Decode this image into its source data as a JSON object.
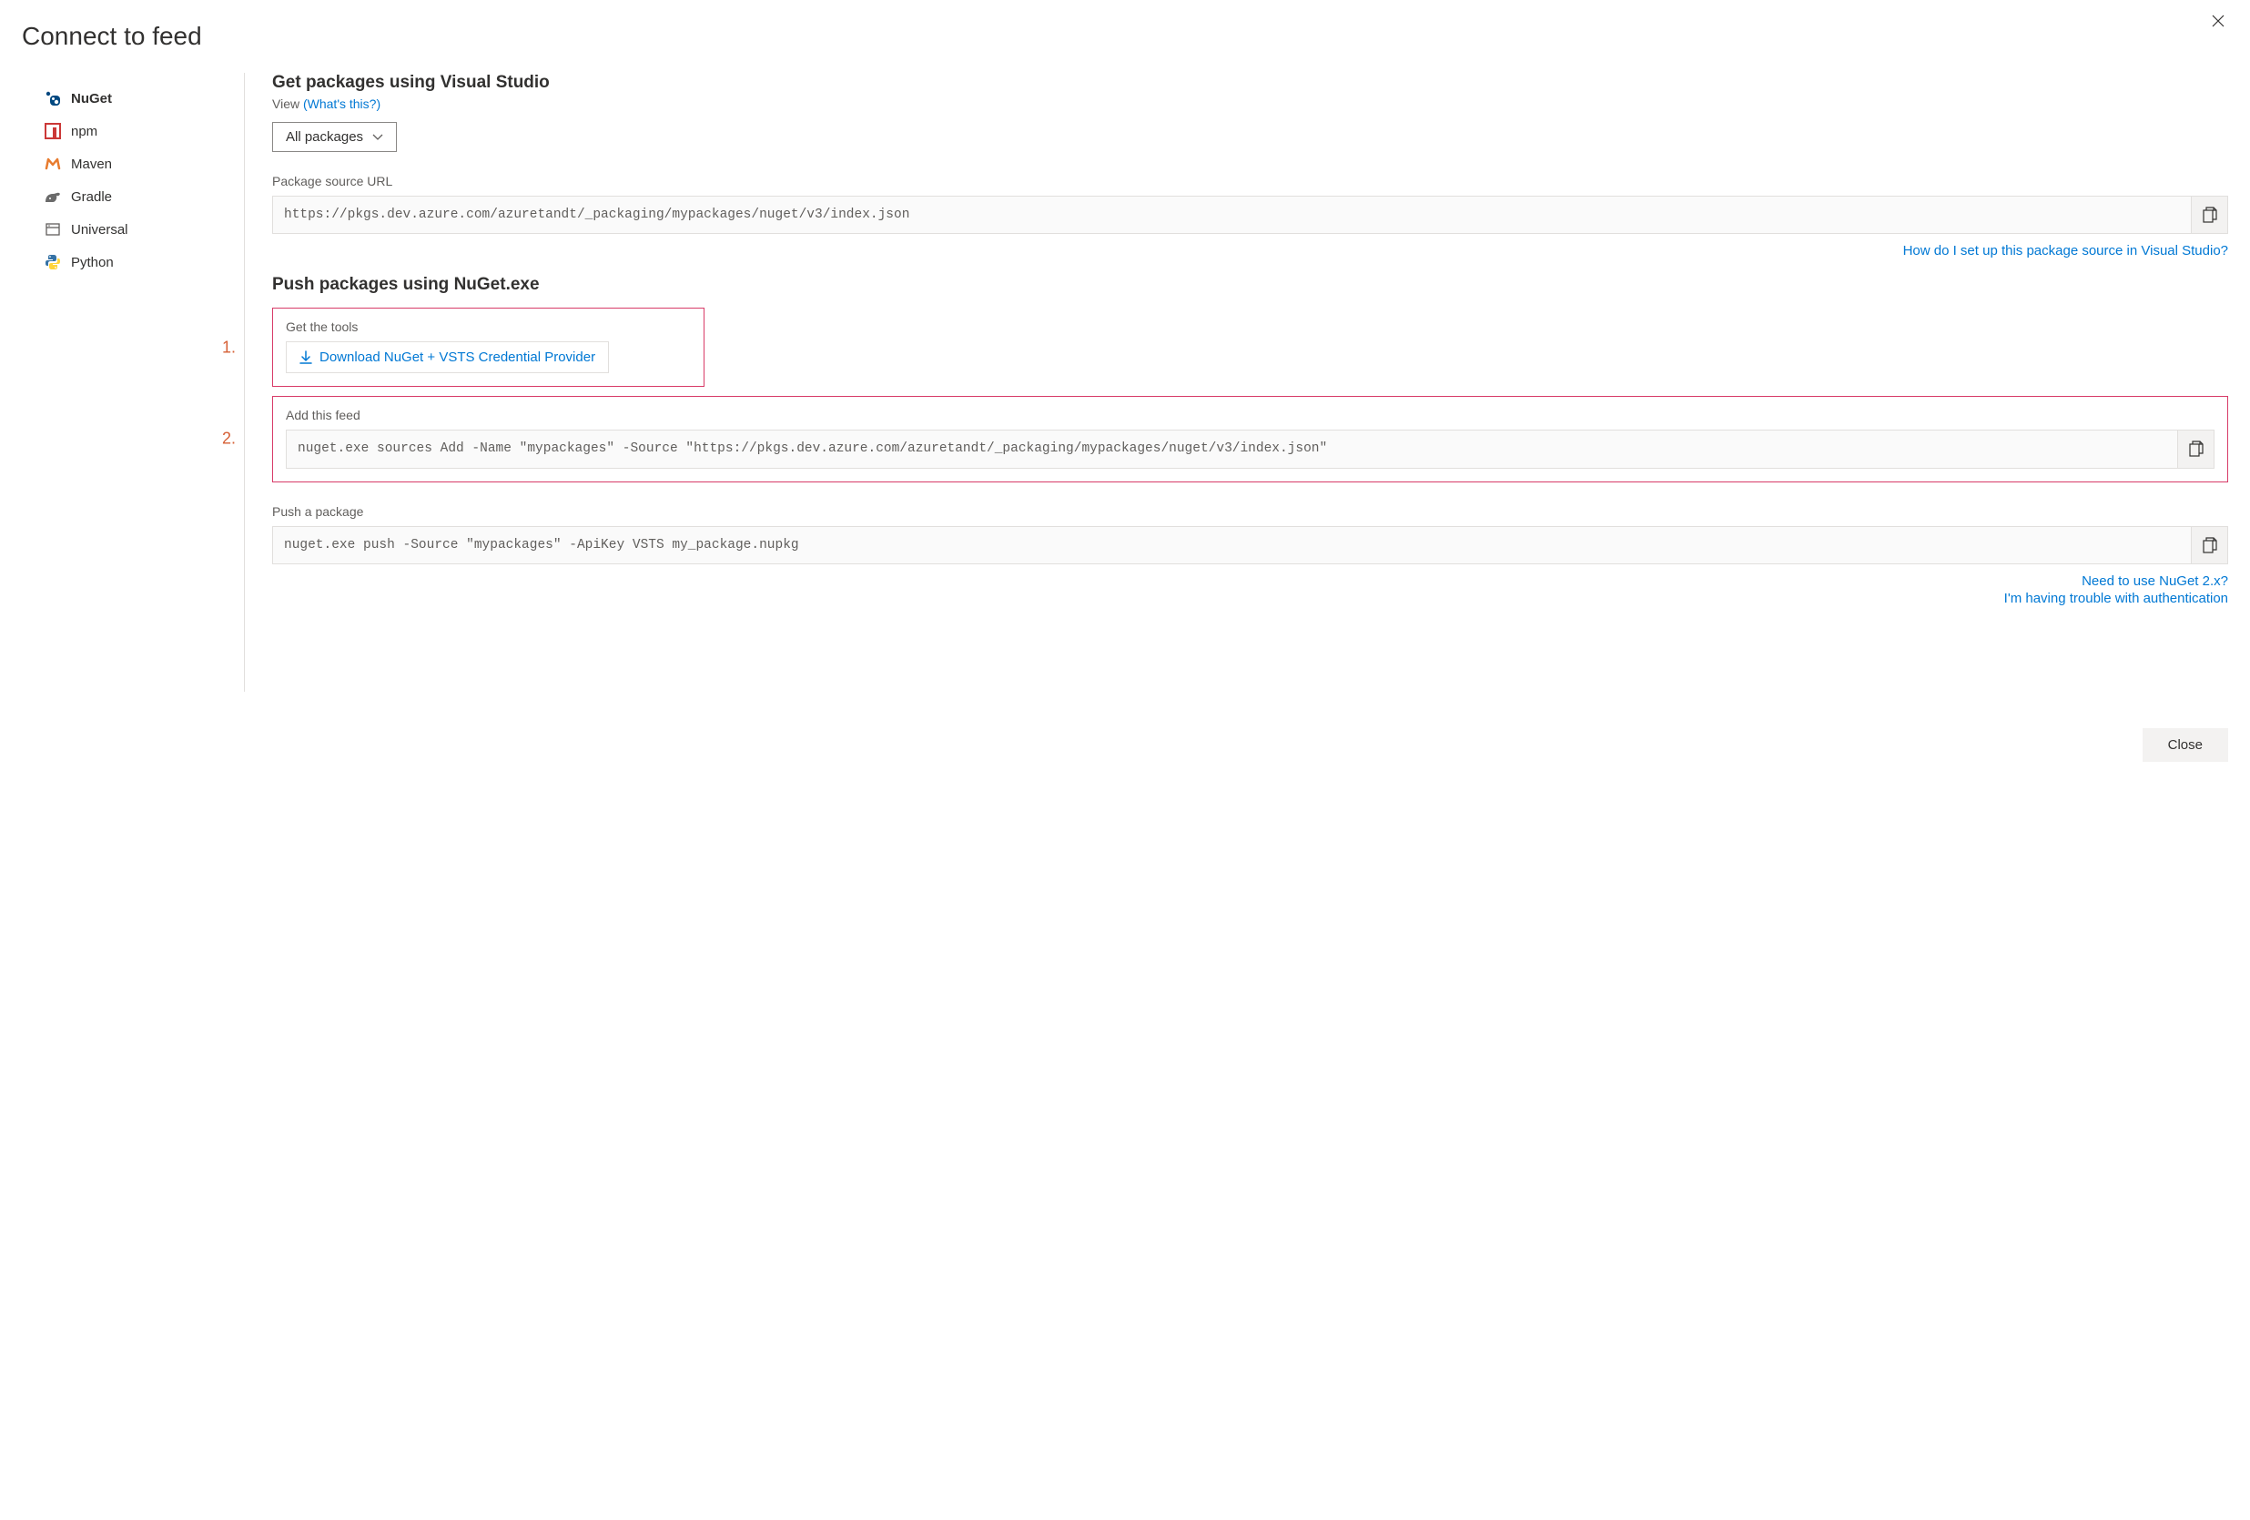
{
  "dialog": {
    "title": "Connect to feed",
    "close_button_label": "Close"
  },
  "sidebar": {
    "items": [
      {
        "label": "NuGet",
        "active": true
      },
      {
        "label": "npm",
        "active": false
      },
      {
        "label": "Maven",
        "active": false
      },
      {
        "label": "Gradle",
        "active": false
      },
      {
        "label": "Universal",
        "active": false
      },
      {
        "label": "Python",
        "active": false
      }
    ]
  },
  "content": {
    "get_section_heading": "Get packages using Visual Studio",
    "view_label": "View",
    "view_help_link": "(What's this?)",
    "view_dropdown_selected": "All packages",
    "package_source_url_label": "Package source URL",
    "package_source_url": "https://pkgs.dev.azure.com/azuretandt/_packaging/mypackages/nuget/v3/index.json",
    "setup_link": "How do I set up this package source in Visual Studio?",
    "push_section_heading": "Push packages using NuGet.exe",
    "annotations": {
      "one": "1.",
      "two": "2."
    },
    "get_tools_label": "Get the tools",
    "download_button_label": "Download NuGet + VSTS Credential Provider",
    "add_feed_label": "Add this feed",
    "add_feed_command": "nuget.exe sources Add -Name \"mypackages\" -Source \"https://pkgs.dev.azure.com/azuretandt/_packaging/mypackages/nuget/v3/index.json\"",
    "push_package_label": "Push a package",
    "push_package_command": "nuget.exe push -Source \"mypackages\" -ApiKey VSTS my_package.nupkg",
    "nuget2_link": "Need to use NuGet 2.x?",
    "auth_trouble_link": "I'm having trouble with authentication"
  }
}
